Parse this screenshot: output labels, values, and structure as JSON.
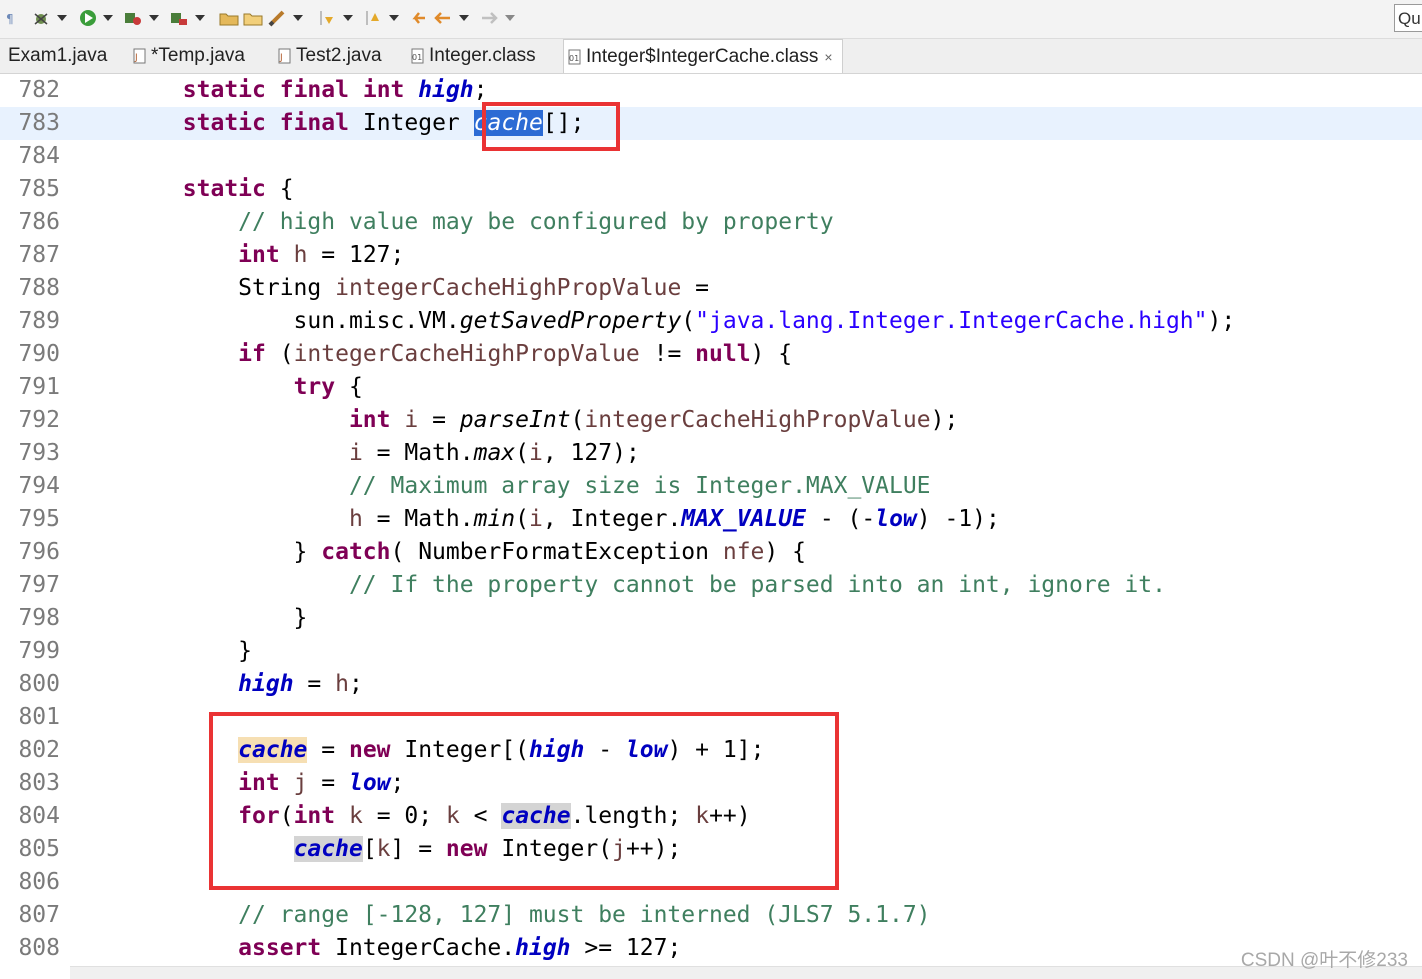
{
  "toolbar": {
    "icons": [
      "pilcrow-icon",
      "debug-icon",
      "dropdown-icon",
      "run-icon",
      "dropdown-icon",
      "coverage-icon",
      "dropdown-icon",
      "external-tools-icon",
      "dropdown-icon",
      "open-type-icon",
      "open-folder-icon",
      "pen-icon",
      "dropdown-icon",
      "next-annotation-icon",
      "dropdown-icon",
      "prev-annotation-icon",
      "dropdown-icon",
      "last-edit-icon",
      "back-icon",
      "dropdown-icon",
      "forward-icon",
      "dropdown-icon"
    ],
    "quick_access_label": "Qu"
  },
  "tabs": [
    {
      "label": "Exam1.java",
      "icon": "java-file-icon",
      "active": false
    },
    {
      "label": "*Temp.java",
      "icon": "java-file-icon",
      "active": false
    },
    {
      "label": "Test2.java",
      "icon": "java-file-icon",
      "active": false
    },
    {
      "label": "Integer.class",
      "icon": "class-file-icon",
      "active": false
    },
    {
      "label": "Integer$IntegerCache.class",
      "icon": "class-file-icon",
      "active": true,
      "close": "×"
    }
  ],
  "editor": {
    "current_line": 783,
    "lines": [
      {
        "n": "782",
        "tokens": [
          [
            "        ",
            ""
          ],
          [
            "static",
            "k"
          ],
          [
            " ",
            ""
          ],
          [
            "final",
            "k"
          ],
          [
            " ",
            ""
          ],
          [
            "int",
            "k"
          ],
          [
            " ",
            ""
          ],
          [
            "high",
            "fb"
          ],
          [
            ";",
            ""
          ]
        ]
      },
      {
        "n": "783",
        "tokens": [
          [
            "        ",
            ""
          ],
          [
            "static",
            "k"
          ],
          [
            " ",
            ""
          ],
          [
            "final",
            "k"
          ],
          [
            " ",
            ""
          ],
          [
            "Integer ",
            ""
          ],
          [
            "cache",
            "sel"
          ],
          [
            "[];",
            ""
          ]
        ]
      },
      {
        "n": "784",
        "tokens": []
      },
      {
        "n": "785",
        "tokens": [
          [
            "        ",
            ""
          ],
          [
            "static",
            "k"
          ],
          [
            " {",
            ""
          ]
        ]
      },
      {
        "n": "786",
        "tokens": [
          [
            "            ",
            ""
          ],
          [
            "// high value may be configured by property",
            "c"
          ]
        ]
      },
      {
        "n": "787",
        "tokens": [
          [
            "            ",
            ""
          ],
          [
            "int",
            "k"
          ],
          [
            " ",
            ""
          ],
          [
            "h",
            "lv"
          ],
          [
            " = 127;",
            ""
          ]
        ]
      },
      {
        "n": "788",
        "tokens": [
          [
            "            String ",
            ""
          ],
          [
            "integerCacheHighPropValue",
            "lv"
          ],
          [
            " =",
            ""
          ]
        ]
      },
      {
        "n": "789",
        "tokens": [
          [
            "                sun.misc.VM.",
            ""
          ],
          [
            "getSavedProperty",
            "m"
          ],
          [
            "(",
            ""
          ],
          [
            "\"java.lang.Integer.IntegerCache.high\"",
            "s"
          ],
          [
            ");",
            ""
          ]
        ]
      },
      {
        "n": "790",
        "tokens": [
          [
            "            ",
            ""
          ],
          [
            "if",
            "k"
          ],
          [
            " (",
            ""
          ],
          [
            "integerCacheHighPropValue",
            "lv"
          ],
          [
            " != ",
            ""
          ],
          [
            "null",
            "k"
          ],
          [
            ") {",
            ""
          ]
        ]
      },
      {
        "n": "791",
        "tokens": [
          [
            "                ",
            ""
          ],
          [
            "try",
            "k"
          ],
          [
            " {",
            ""
          ]
        ]
      },
      {
        "n": "792",
        "tokens": [
          [
            "                    ",
            ""
          ],
          [
            "int",
            "k"
          ],
          [
            " ",
            ""
          ],
          [
            "i",
            "lv"
          ],
          [
            " = ",
            ""
          ],
          [
            "parseInt",
            "m"
          ],
          [
            "(",
            ""
          ],
          [
            "integerCacheHighPropValue",
            "lv"
          ],
          [
            ");",
            ""
          ]
        ]
      },
      {
        "n": "793",
        "tokens": [
          [
            "                    ",
            ""
          ],
          [
            "i",
            "lv"
          ],
          [
            " = Math.",
            ""
          ],
          [
            "max",
            "m"
          ],
          [
            "(",
            ""
          ],
          [
            "i",
            "lv"
          ],
          [
            ", 127);",
            ""
          ]
        ]
      },
      {
        "n": "794",
        "tokens": [
          [
            "                    ",
            ""
          ],
          [
            "// Maximum array size is Integer.MAX_VALUE",
            "c"
          ]
        ]
      },
      {
        "n": "795",
        "tokens": [
          [
            "                    ",
            ""
          ],
          [
            "h",
            "lv"
          ],
          [
            " = Math.",
            ""
          ],
          [
            "min",
            "m"
          ],
          [
            "(",
            ""
          ],
          [
            "i",
            "lv"
          ],
          [
            ", Integer.",
            ""
          ],
          [
            "MAX_VALUE",
            "fb"
          ],
          [
            " - (-",
            ""
          ],
          [
            "low",
            "fb"
          ],
          [
            ") -1);",
            ""
          ]
        ]
      },
      {
        "n": "796",
        "tokens": [
          [
            "                } ",
            ""
          ],
          [
            "catch",
            "k"
          ],
          [
            "( NumberFormatException ",
            ""
          ],
          [
            "nfe",
            "lv"
          ],
          [
            ") {",
            ""
          ]
        ]
      },
      {
        "n": "797",
        "tokens": [
          [
            "                    ",
            ""
          ],
          [
            "// If the property cannot be parsed into an int, ignore it.",
            "c"
          ]
        ]
      },
      {
        "n": "798",
        "tokens": [
          [
            "                }",
            ""
          ]
        ]
      },
      {
        "n": "799",
        "tokens": [
          [
            "            }",
            ""
          ]
        ]
      },
      {
        "n": "800",
        "tokens": [
          [
            "            ",
            ""
          ],
          [
            "high",
            "fb"
          ],
          [
            " = ",
            ""
          ],
          [
            "h",
            "lv"
          ],
          [
            ";",
            ""
          ]
        ]
      },
      {
        "n": "801",
        "tokens": []
      },
      {
        "n": "802",
        "tokens": [
          [
            "            ",
            ""
          ],
          [
            "cache",
            "fb occw"
          ],
          [
            " = ",
            ""
          ],
          [
            "new",
            "k"
          ],
          [
            " Integer[(",
            ""
          ],
          [
            "high",
            "fb"
          ],
          [
            " - ",
            ""
          ],
          [
            "low",
            "fb"
          ],
          [
            ") + 1];",
            ""
          ]
        ]
      },
      {
        "n": "803",
        "tokens": [
          [
            "            ",
            ""
          ],
          [
            "int",
            "k"
          ],
          [
            " ",
            ""
          ],
          [
            "j",
            "lv"
          ],
          [
            " = ",
            ""
          ],
          [
            "low",
            "fb"
          ],
          [
            ";",
            ""
          ]
        ]
      },
      {
        "n": "804",
        "tokens": [
          [
            "            ",
            ""
          ],
          [
            "for",
            "k"
          ],
          [
            "(",
            ""
          ],
          [
            "int",
            "k"
          ],
          [
            " ",
            ""
          ],
          [
            "k",
            "lv"
          ],
          [
            " = 0; ",
            ""
          ],
          [
            "k",
            "lv"
          ],
          [
            " < ",
            ""
          ],
          [
            "cache",
            "fb occ"
          ],
          [
            ".length; ",
            ""
          ],
          [
            "k",
            "lv"
          ],
          [
            "++)",
            ""
          ]
        ]
      },
      {
        "n": "805",
        "tokens": [
          [
            "                ",
            ""
          ],
          [
            "cache",
            "fb occ"
          ],
          [
            "[",
            ""
          ],
          [
            "k",
            "lv"
          ],
          [
            "] = ",
            ""
          ],
          [
            "new",
            "k"
          ],
          [
            " Integer(",
            ""
          ],
          [
            "j",
            "lv"
          ],
          [
            "++);",
            ""
          ]
        ]
      },
      {
        "n": "806",
        "tokens": []
      },
      {
        "n": "807",
        "tokens": [
          [
            "            ",
            ""
          ],
          [
            "// range [-128, 127] must be interned (JLS7 5.1.7)",
            "c"
          ]
        ]
      },
      {
        "n": "808",
        "tokens": [
          [
            "            ",
            ""
          ],
          [
            "assert",
            "k"
          ],
          [
            " IntegerCache.",
            ""
          ],
          [
            "high",
            "fb"
          ],
          [
            " >= 127;",
            ""
          ]
        ]
      }
    ]
  },
  "watermark": "CSDN @叶不修233",
  "colors": {
    "highlight_box": "#ea3334",
    "selection": "#2c6bd4",
    "keyword": "#7f0055",
    "comment": "#3f7f5f",
    "string": "#2a00ff",
    "field": "#0000c0"
  }
}
